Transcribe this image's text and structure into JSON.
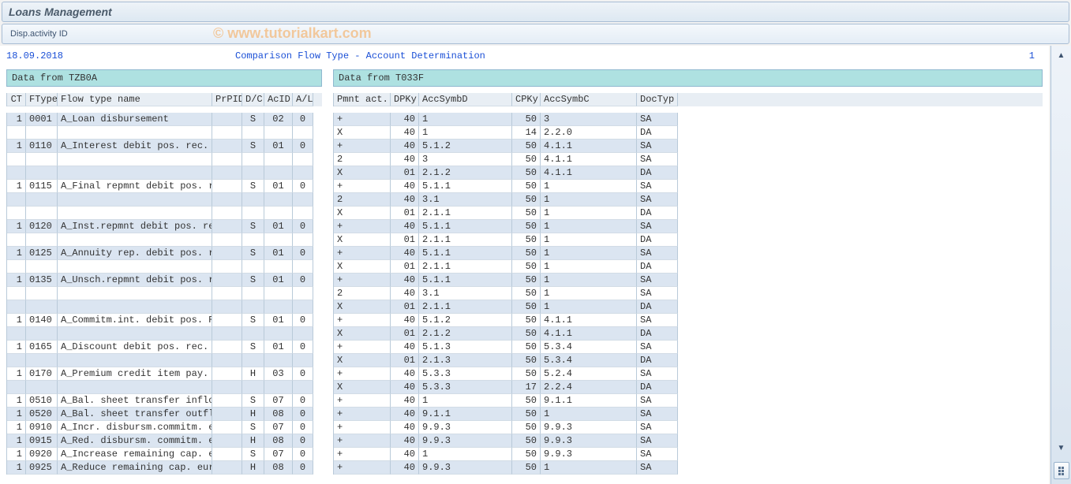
{
  "header": {
    "title": "Loans Management"
  },
  "toolbar": {
    "label": "Disp.activity ID"
  },
  "watermark": "© www.tutorialkart.com",
  "report": {
    "date": "18.09.2018",
    "title": "Comparison Flow Type - Account Determination",
    "page": "1"
  },
  "left": {
    "panel_title": "Data from TZB0A",
    "cols": {
      "ct": "CT",
      "ftype": "FType",
      "name": "Flow type name",
      "prpid": "PrPID",
      "dc": "D/C",
      "acid": "AcID",
      "al": "A/L"
    }
  },
  "right": {
    "panel_title": "Data from T033F",
    "cols": {
      "pmnt": "Pmnt act.",
      "dpky": "DPKy",
      "asymd": "AccSymbD",
      "cpky": "CPKy",
      "asymc": "AccSymbC",
      "doc": "DocTyp"
    }
  },
  "rows": [
    {
      "s": 1,
      "ct": "1",
      "ft": "0001",
      "name": "A_Loan disbursement",
      "dc": "S",
      "acid": "02",
      "al": "0",
      "pmnt": "+",
      "dpky": "40",
      "asymd": "1",
      "cpky": "50",
      "asymc": "3",
      "doc": "SA"
    },
    {
      "s": 0,
      "ct": "",
      "ft": "",
      "name": "",
      "dc": "",
      "acid": "",
      "al": "",
      "pmnt": "X",
      "dpky": "40",
      "asymd": "1",
      "cpky": "14",
      "asymc": "2.2.0",
      "doc": "DA"
    },
    {
      "s": 1,
      "ct": "1",
      "ft": "0110",
      "name": "A_Interest debit pos. rec.",
      "dc": "S",
      "acid": "01",
      "al": "0",
      "pmnt": "+",
      "dpky": "40",
      "asymd": "5.1.2",
      "cpky": "50",
      "asymc": "4.1.1",
      "doc": "SA"
    },
    {
      "s": 0,
      "ct": "",
      "ft": "",
      "name": "",
      "dc": "",
      "acid": "",
      "al": "",
      "pmnt": "2",
      "dpky": "40",
      "asymd": "3",
      "cpky": "50",
      "asymc": "4.1.1",
      "doc": "SA"
    },
    {
      "s": 1,
      "ct": "",
      "ft": "",
      "name": "",
      "dc": "",
      "acid": "",
      "al": "",
      "pmnt": "X",
      "dpky": "01",
      "asymd": "2.1.2",
      "cpky": "50",
      "asymc": "4.1.1",
      "doc": "DA"
    },
    {
      "s": 0,
      "ct": "1",
      "ft": "0115",
      "name": "A_Final repmnt debit pos. r",
      "dc": "S",
      "acid": "01",
      "al": "0",
      "pmnt": "+",
      "dpky": "40",
      "asymd": "5.1.1",
      "cpky": "50",
      "asymc": "1",
      "doc": "SA"
    },
    {
      "s": 1,
      "ct": "",
      "ft": "",
      "name": "",
      "dc": "",
      "acid": "",
      "al": "",
      "pmnt": "2",
      "dpky": "40",
      "asymd": "3.1",
      "cpky": "50",
      "asymc": "1",
      "doc": "SA"
    },
    {
      "s": 0,
      "ct": "",
      "ft": "",
      "name": "",
      "dc": "",
      "acid": "",
      "al": "",
      "pmnt": "X",
      "dpky": "01",
      "asymd": "2.1.1",
      "cpky": "50",
      "asymc": "1",
      "doc": "DA"
    },
    {
      "s": 1,
      "ct": "1",
      "ft": "0120",
      "name": "A_Inst.repmnt debit pos. re",
      "dc": "S",
      "acid": "01",
      "al": "0",
      "pmnt": "+",
      "dpky": "40",
      "asymd": "5.1.1",
      "cpky": "50",
      "asymc": "1",
      "doc": "SA"
    },
    {
      "s": 0,
      "ct": "",
      "ft": "",
      "name": "",
      "dc": "",
      "acid": "",
      "al": "",
      "pmnt": "X",
      "dpky": "01",
      "asymd": "2.1.1",
      "cpky": "50",
      "asymc": "1",
      "doc": "DA"
    },
    {
      "s": 1,
      "ct": "1",
      "ft": "0125",
      "name": "A_Annuity rep. debit pos. r",
      "dc": "S",
      "acid": "01",
      "al": "0",
      "pmnt": "+",
      "dpky": "40",
      "asymd": "5.1.1",
      "cpky": "50",
      "asymc": "1",
      "doc": "SA"
    },
    {
      "s": 0,
      "ct": "",
      "ft": "",
      "name": "",
      "dc": "",
      "acid": "",
      "al": "",
      "pmnt": "X",
      "dpky": "01",
      "asymd": "2.1.1",
      "cpky": "50",
      "asymc": "1",
      "doc": "DA"
    },
    {
      "s": 1,
      "ct": "1",
      "ft": "0135",
      "name": "A_Unsch.repmnt debit pos. r",
      "dc": "S",
      "acid": "01",
      "al": "0",
      "pmnt": "+",
      "dpky": "40",
      "asymd": "5.1.1",
      "cpky": "50",
      "asymc": "1",
      "doc": "SA"
    },
    {
      "s": 0,
      "ct": "",
      "ft": "",
      "name": "",
      "dc": "",
      "acid": "",
      "al": "",
      "pmnt": "2",
      "dpky": "40",
      "asymd": "3.1",
      "cpky": "50",
      "asymc": "1",
      "doc": "SA"
    },
    {
      "s": 1,
      "ct": "",
      "ft": "",
      "name": "",
      "dc": "",
      "acid": "",
      "al": "",
      "pmnt": "X",
      "dpky": "01",
      "asymd": "2.1.1",
      "cpky": "50",
      "asymc": "1",
      "doc": "DA"
    },
    {
      "s": 0,
      "ct": "1",
      "ft": "0140",
      "name": "A_Commitm.int. debit pos. R",
      "dc": "S",
      "acid": "01",
      "al": "0",
      "pmnt": "+",
      "dpky": "40",
      "asymd": "5.1.2",
      "cpky": "50",
      "asymc": "4.1.1",
      "doc": "SA"
    },
    {
      "s": 1,
      "ct": "",
      "ft": "",
      "name": "",
      "dc": "",
      "acid": "",
      "al": "",
      "pmnt": "X",
      "dpky": "01",
      "asymd": "2.1.2",
      "cpky": "50",
      "asymc": "4.1.1",
      "doc": "DA"
    },
    {
      "s": 0,
      "ct": "1",
      "ft": "0165",
      "name": "A_Discount debit pos. rec.",
      "dc": "S",
      "acid": "01",
      "al": "0",
      "pmnt": "+",
      "dpky": "40",
      "asymd": "5.1.3",
      "cpky": "50",
      "asymc": "5.3.4",
      "doc": "SA"
    },
    {
      "s": 1,
      "ct": "",
      "ft": "",
      "name": "",
      "dc": "",
      "acid": "",
      "al": "",
      "pmnt": "X",
      "dpky": "01",
      "asymd": "2.1.3",
      "cpky": "50",
      "asymc": "5.3.4",
      "doc": "DA"
    },
    {
      "s": 0,
      "ct": "1",
      "ft": "0170",
      "name": "A_Premium credit item pay.",
      "dc": "H",
      "acid": "03",
      "al": "0",
      "pmnt": "+",
      "dpky": "40",
      "asymd": "5.3.3",
      "cpky": "50",
      "asymc": "5.2.4",
      "doc": "SA"
    },
    {
      "s": 1,
      "ct": "",
      "ft": "",
      "name": "",
      "dc": "",
      "acid": "",
      "al": "",
      "pmnt": "X",
      "dpky": "40",
      "asymd": "5.3.3",
      "cpky": "17",
      "asymc": "2.2.4",
      "doc": "DA"
    },
    {
      "s": 0,
      "ct": "1",
      "ft": "0510",
      "name": "A_Bal. sheet transfer inflo",
      "dc": "S",
      "acid": "07",
      "al": "0",
      "pmnt": "+",
      "dpky": "40",
      "asymd": "1",
      "cpky": "50",
      "asymc": "9.1.1",
      "doc": "SA"
    },
    {
      "s": 1,
      "ct": "1",
      "ft": "0520",
      "name": "A_Bal. sheet transfer outfl",
      "dc": "H",
      "acid": "08",
      "al": "0",
      "pmnt": "+",
      "dpky": "40",
      "asymd": "9.1.1",
      "cpky": "50",
      "asymc": "1",
      "doc": "SA"
    },
    {
      "s": 0,
      "ct": "1",
      "ft": "0910",
      "name": "A_Incr. disbursm.commitm. e",
      "dc": "S",
      "acid": "07",
      "al": "0",
      "pmnt": "+",
      "dpky": "40",
      "asymd": "9.9.3",
      "cpky": "50",
      "asymc": "9.9.3",
      "doc": "SA"
    },
    {
      "s": 1,
      "ct": "1",
      "ft": "0915",
      "name": "A_Red. disbursm. commitm. e",
      "dc": "H",
      "acid": "08",
      "al": "0",
      "pmnt": "+",
      "dpky": "40",
      "asymd": "9.9.3",
      "cpky": "50",
      "asymc": "9.9.3",
      "doc": "SA"
    },
    {
      "s": 0,
      "ct": "1",
      "ft": "0920",
      "name": "A_Increase remaining cap. e",
      "dc": "S",
      "acid": "07",
      "al": "0",
      "pmnt": "+",
      "dpky": "40",
      "asymd": "1",
      "cpky": "50",
      "asymc": "9.9.3",
      "doc": "SA"
    },
    {
      "s": 1,
      "ct": "1",
      "ft": "0925",
      "name": "A_Reduce remaining cap. eur",
      "dc": "H",
      "acid": "08",
      "al": "0",
      "pmnt": "+",
      "dpky": "40",
      "asymd": "9.9.3",
      "cpky": "50",
      "asymc": "1",
      "doc": "SA"
    }
  ]
}
